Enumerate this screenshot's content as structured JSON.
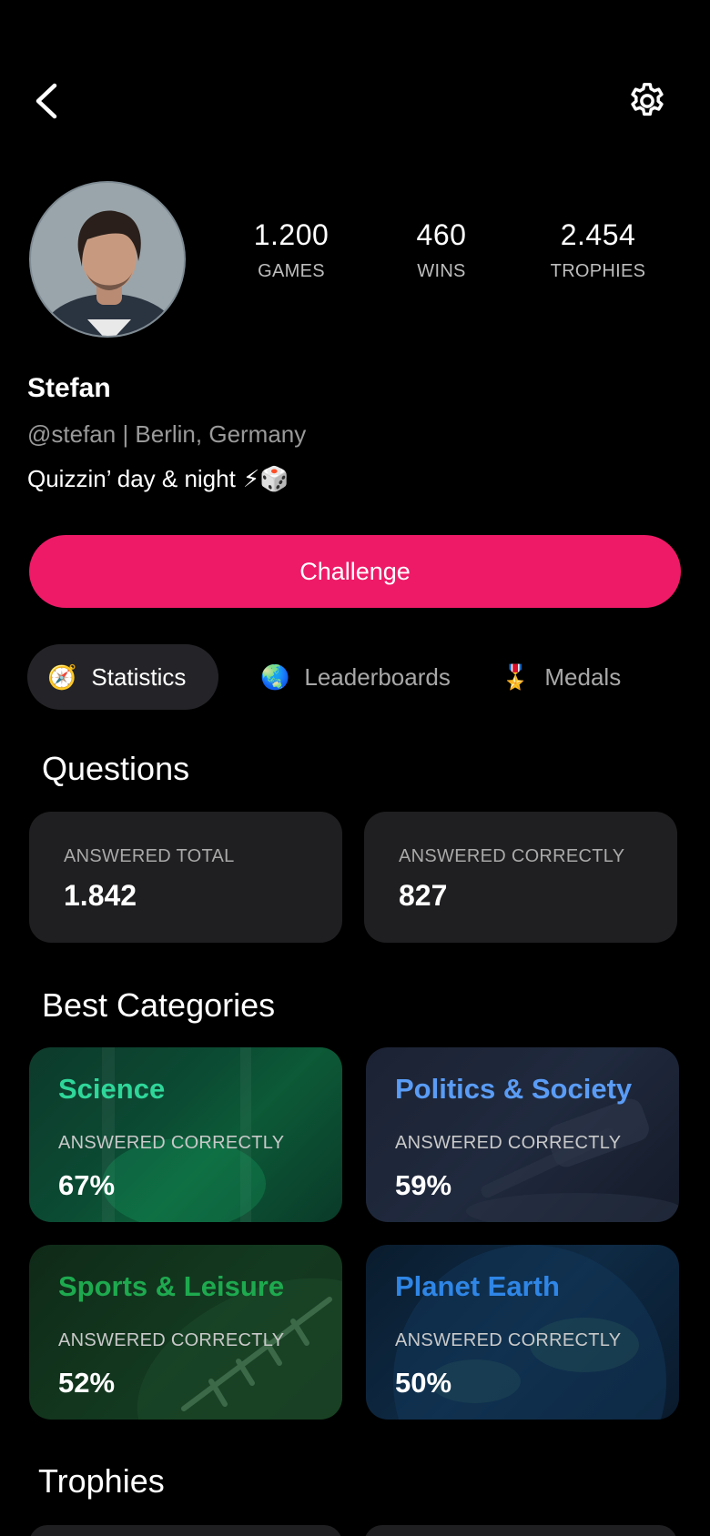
{
  "profile": {
    "name": "Stefan",
    "handle_location": "@stefan | Berlin, Germany",
    "bio": "Quizzin’ day & night",
    "bio_emoji": "⚡🎲"
  },
  "stats": {
    "games": {
      "value": "1.200",
      "label": "GAMES"
    },
    "wins": {
      "value": "460",
      "label": "WINS"
    },
    "trophies": {
      "value": "2.454",
      "label": "TROPHIES"
    }
  },
  "challenge_label": "Challenge",
  "tabs": [
    {
      "label": "Statistics",
      "icon": "🧭",
      "active": true
    },
    {
      "label": "Leaderboards",
      "icon": "🌏",
      "active": false
    },
    {
      "label": "Medals",
      "icon": "🎖️",
      "active": false
    }
  ],
  "questions": {
    "title": "Questions",
    "answered_total": {
      "label": "ANSWERED TOTAL",
      "value": "1.842"
    },
    "answered_correctly": {
      "label": "ANSWERED CORRECTLY",
      "value": "827"
    }
  },
  "best_categories": {
    "title": "Best Categories",
    "items": [
      {
        "name": "Science",
        "label": "ANSWERED CORRECTLY",
        "value": "67%",
        "color": "#2fd69a"
      },
      {
        "name": "Politics & Society",
        "label": "ANSWERED CORRECTLY",
        "value": "59%",
        "color": "#5a9cf5"
      },
      {
        "name": "Sports & Leisure",
        "label": "ANSWERED CORRECTLY",
        "value": "52%",
        "color": "#1ea94f"
      },
      {
        "name": "Planet Earth",
        "label": "ANSWERED CORRECTLY",
        "value": "50%",
        "color": "#2f86e6"
      }
    ]
  },
  "trophies_title": "Trophies",
  "colors": {
    "accent": "#ee1a67",
    "background": "#000000",
    "card": "#1f1f21"
  },
  "icons": {
    "back": "back-arrow-icon",
    "settings": "gear-icon"
  }
}
